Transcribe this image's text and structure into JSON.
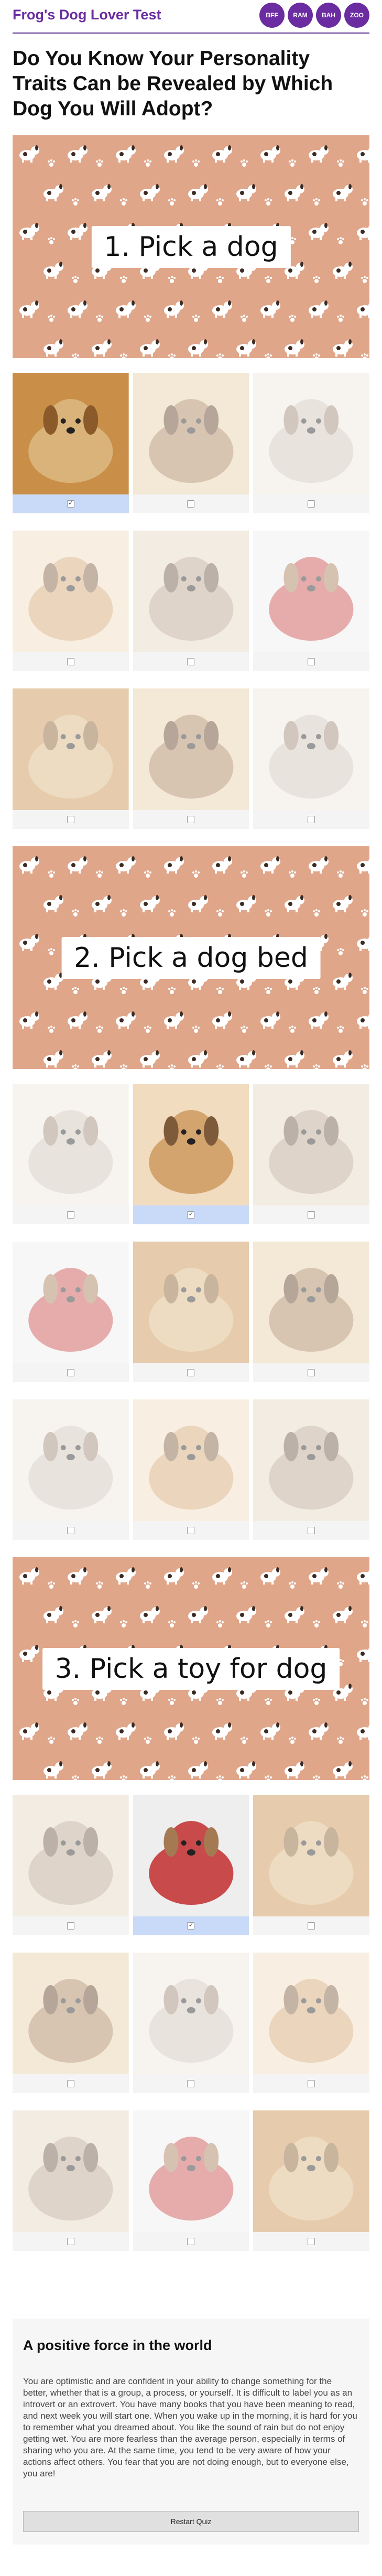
{
  "brand": "Frog's Dog Lover Test",
  "social": [
    "BFF",
    "RAM",
    "BAH",
    "ZOO"
  ],
  "quiz_title": "Do You Know Your Personality Traits Can be Revealed by Which Dog You Will Adopt?",
  "sections": [
    {
      "label": "1. Pick a dog",
      "options": [
        {
          "icon": "golden-retriever-puppy-icon",
          "selected": true
        },
        {
          "icon": "tan-dog-smiling-icon",
          "selected": false
        },
        {
          "icon": "sleeping-dog-icon",
          "selected": false
        },
        {
          "icon": "golden-dog-icon",
          "selected": false
        },
        {
          "icon": "dog-with-toy-icon",
          "selected": false
        },
        {
          "icon": "dog-in-cart-icon",
          "selected": false
        },
        {
          "icon": "dog-with-glasses-icon",
          "selected": false
        },
        {
          "icon": "black-puppy-icon",
          "selected": false
        },
        {
          "icon": "puppy-on-floor-icon",
          "selected": false
        }
      ]
    },
    {
      "label": "2. Pick a dog bed",
      "options": [
        {
          "icon": "round-dog-bed-icon",
          "selected": false
        },
        {
          "icon": "red-dog-bed-icon",
          "selected": true
        },
        {
          "icon": "white-blanket-bed-icon",
          "selected": false
        },
        {
          "icon": "pink-dog-bed-icon",
          "selected": false
        },
        {
          "icon": "burger-dog-bed-icon",
          "selected": false
        },
        {
          "icon": "teepee-bed-icon",
          "selected": false
        },
        {
          "icon": "tent-bed-icon",
          "selected": false
        },
        {
          "icon": "cat-shaped-bed-icon",
          "selected": false
        },
        {
          "icon": "raised-cot-bed-icon",
          "selected": false
        }
      ]
    },
    {
      "label": "3. Pick a toy for dog",
      "options": [
        {
          "icon": "plush-moose-toy-icon",
          "selected": false
        },
        {
          "icon": "lab-with-shoe-icon",
          "selected": true
        },
        {
          "icon": "tennis-ball-toy-icon",
          "selected": false
        },
        {
          "icon": "big-ball-toy-icon",
          "selected": false
        },
        {
          "icon": "burger-toy-icon",
          "selected": false
        },
        {
          "icon": "pretzel-toy-icon",
          "selected": false
        },
        {
          "icon": "rope-toy-icon",
          "selected": false
        },
        {
          "icon": "duck-toy-icon",
          "selected": false
        },
        {
          "icon": "taco-toy-icon",
          "selected": false
        }
      ]
    }
  ],
  "result": {
    "title": "A positive force in the world",
    "text": "You are optimistic and are confident in your ability to change something for the better, whether that is a group, a process, or yourself. It is difficult to label you as an introvert or an extrovert. You have many books that you have been meaning to read, and next week you will start one. When you wake up in the morning, it is hard for you to remember what you dreamed about. You like the sound of rain but do not enjoy getting wet. You are more fearless than the average person, especially in terms of sharing who you are. At the same time, you tend to be very aware of how your actions affect others. You fear that you are not doing enough, but to everyone else, you are!",
    "restart_label": "Restart Quiz"
  },
  "colors": {
    "brand": "#6a2ca0",
    "banner": "#e0a68a",
    "selected": "#c9daf8"
  }
}
